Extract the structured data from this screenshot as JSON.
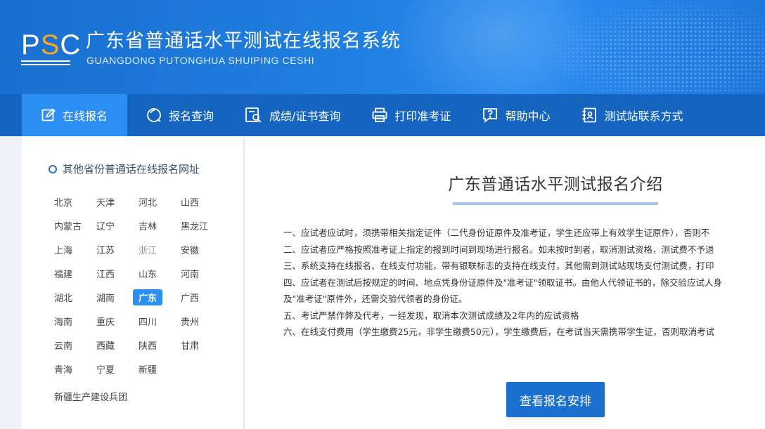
{
  "header": {
    "logo_text_p": "P",
    "logo_text_s": "S",
    "logo_text_c": "C",
    "title": "广东省普通话水平测试在线报名系统",
    "subtitle": "GUANGDONG PUTONGHUA SHUIPING CESHI"
  },
  "nav": {
    "items": [
      {
        "label": "在线报名",
        "icon": "edit-icon"
      },
      {
        "label": "报名查询",
        "icon": "search-icon"
      },
      {
        "label": "成绩/证书查询",
        "icon": "certificate-search-icon"
      },
      {
        "label": "打印准考证",
        "icon": "printer-icon"
      },
      {
        "label": "帮助中心",
        "icon": "help-chat-icon"
      },
      {
        "label": "测试站联系方式",
        "icon": "contact-card-icon"
      }
    ],
    "active_index": 0
  },
  "sidebar": {
    "title": "其他省份普通话在线报名网址",
    "provinces": [
      "北京",
      "天津",
      "河北",
      "山西",
      "内蒙古",
      "辽宁",
      "吉林",
      "黑龙江",
      "上海",
      "江苏",
      "浙江",
      "安徽",
      "福建",
      "江西",
      "山东",
      "河南",
      "湖北",
      "湖南",
      "广东",
      "广西",
      "海南",
      "重庆",
      "四川",
      "贵州",
      "云南",
      "西藏",
      "陕西",
      "甘肃",
      "青海",
      "宁夏",
      "新疆"
    ],
    "current_province": "广东",
    "disabled_province": "浙江",
    "bingtuan": "新疆生产建设兵团"
  },
  "main": {
    "title": "广东普通话水平测试报名介绍",
    "rules": [
      "一、应试者应试时，须携带相关指定证件（二代身份证原件及准考证，学生还应带上有效学生证原件），否则不",
      "二、应试者应严格按照准考证上指定的报到时间到现场进行报名。如未按时到者，取消测试资格，测试费不予退",
      "三、系统支持在线报名、在线支付功能，带有银联标志的支持在线支付，其他需到测试站现场支付测试费，打印",
      "四、应试者在测试后按规定的时间、地点凭身份证原件及\"准考证\"领取证书。由他人代领证书的，除交验应试人身",
      "及\"准考证\"原件外，还需交验代领者的身份证。",
      "五、考试严禁作弊及代考，一经发现，取消本次测试成绩及2年内的应试资格",
      "六、在线支付费用（学生缴费25元，非学生缴费50元），学生缴费后，在考试当天需携带学生证，否则取消考试"
    ],
    "button_label": "查看报名安排"
  },
  "colors": {
    "header_blue": "#1f7fe0",
    "nav_blue": "#1565c0",
    "nav_active": "#2b8ef2",
    "logo_accent": "#f5a623",
    "button_blue": "#1b6fce"
  }
}
